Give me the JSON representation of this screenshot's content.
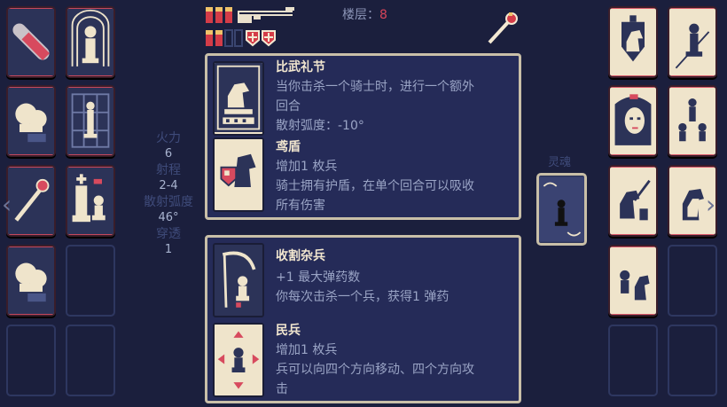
{
  "hud": {
    "floor_label": "楼层：",
    "floor_value": "8"
  },
  "stats": [
    {
      "label": "火力",
      "value": "6"
    },
    {
      "label": "射程",
      "value": "2-4"
    },
    {
      "label": "散射弧度",
      "value": "46°"
    },
    {
      "label": "穿透",
      "value": "1"
    }
  ],
  "soul_label": "灵魂",
  "upgrades": [
    {
      "title": "比武礼节",
      "lines": [
        "当你击杀一个骑士时，进行一个额外",
        "回合",
        "散射弧度：-10°"
      ]
    },
    {
      "title": "鸢盾",
      "lines": [
        "增加1 枚兵",
        "骑士拥有护盾，在单个回合可以吸收",
        "所有伤害"
      ]
    },
    {
      "title": "收割杂兵",
      "lines": [
        "+1 最大弹药数",
        "你每次击杀一个兵，获得1 弹药"
      ]
    },
    {
      "title": "民兵",
      "lines": [
        "增加1 枚兵",
        "兵可以向四个方向移动、四个方向攻",
        "击"
      ]
    }
  ],
  "icons": {
    "weapon": "shotgun-icon",
    "ammo": "shell-icon",
    "shield": "heart-shield-icon",
    "cursor": "scepter-cursor-icon"
  },
  "colors": {
    "background": "#1b1f3d",
    "card": "#efe4cb",
    "accent": "#d74a5e",
    "panel": "#252b58"
  }
}
